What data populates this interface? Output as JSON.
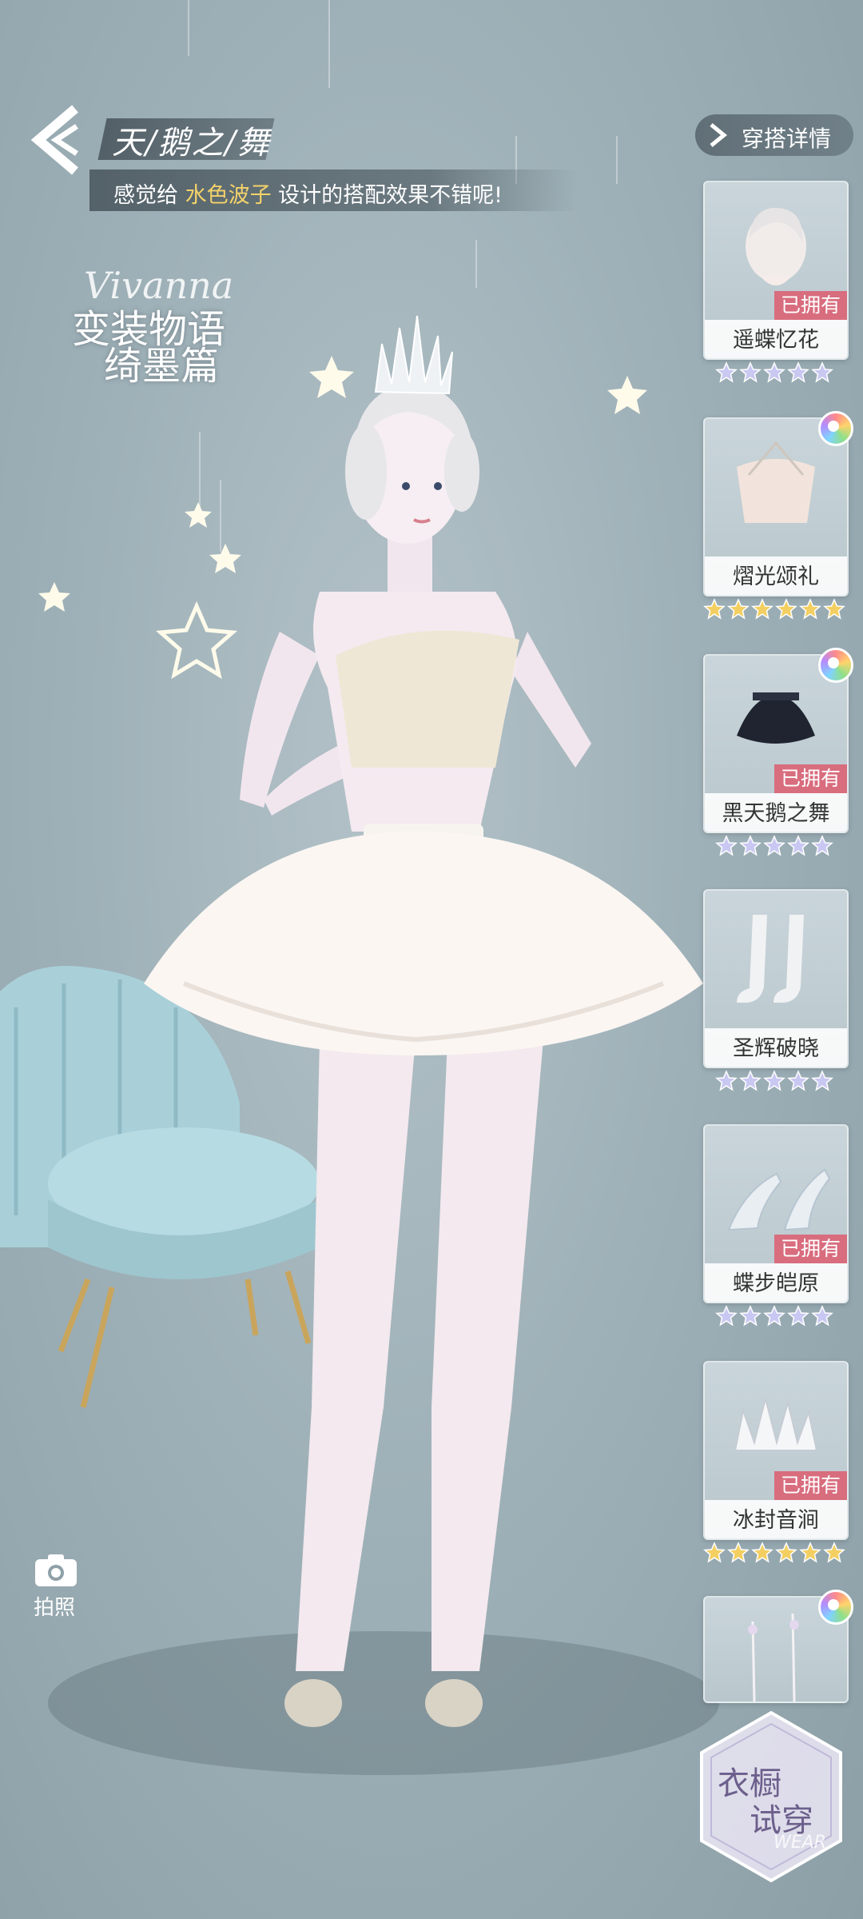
{
  "header": {
    "title": "天/鹅之/舞",
    "subtitle_pre": "感觉给 ",
    "subtitle_highlight": "水色波子",
    "subtitle_post": " 设计的搭配效果不错呢!"
  },
  "logo": {
    "script": "Vivanna",
    "line1": "变装物语",
    "line2": "绮墨篇"
  },
  "detail_button": {
    "label": "穿搭详情"
  },
  "items": [
    {
      "name": "遥蝶忆花",
      "owned": "已拥有",
      "stars": 5,
      "star_color": "#c9c8f2",
      "color_badge": false
    },
    {
      "name": "熠光颂礼",
      "owned": "",
      "stars": 6,
      "star_color": "#f3cf62",
      "color_badge": true
    },
    {
      "name": "黑天鹅之舞",
      "owned": "已拥有",
      "stars": 5,
      "star_color": "#c9c8f2",
      "color_badge": true
    },
    {
      "name": "圣辉破晓",
      "owned": "",
      "stars": 5,
      "star_color": "#c9c8f2",
      "color_badge": false
    },
    {
      "name": "蝶步皑原",
      "owned": "已拥有",
      "stars": 5,
      "star_color": "#c9c8f2",
      "color_badge": false
    },
    {
      "name": "冰封音涧",
      "owned": "已拥有",
      "stars": 6,
      "star_color": "#f3cf62",
      "color_badge": false
    },
    {
      "name": "",
      "owned": "",
      "stars": 0,
      "star_color": "#c9c8f2",
      "color_badge": true
    }
  ],
  "camera": {
    "label": "拍照"
  },
  "wardrobe": {
    "line1": "衣橱",
    "line2": "试穿",
    "sub": "WEAR"
  },
  "colors": {
    "owned_badge": "#d86d7e",
    "highlight": "#f4d36a"
  }
}
